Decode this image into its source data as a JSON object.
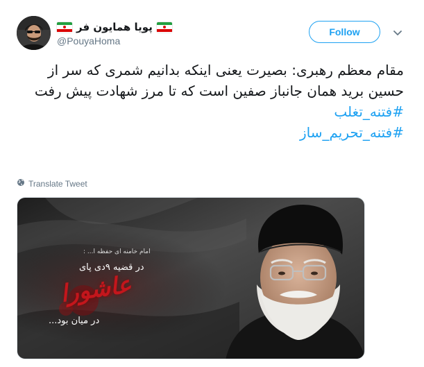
{
  "user": {
    "display_name": "پویا همایون فر",
    "handle": "@PouyaHoma",
    "avatar_icon": "user-avatar",
    "flag_icon": "iran-flag-emoji"
  },
  "actions": {
    "follow_label": "Follow",
    "more_icon": "chevron-down-icon"
  },
  "tweet": {
    "text": "مقام معظم رهبری: بصیرت یعنی اینکه بدانیم شمری که سر از حسین برید همان جانباز صفین است که تا مرز شهادت پیش رفت",
    "hashtags": [
      "#فتنه_تغلب",
      "#فتنه_تحریم_ساز"
    ]
  },
  "translate": {
    "label": "Translate Tweet",
    "icon": "globe-icon"
  },
  "media": {
    "overlay_line1": "امام خامنه ای حفظه ا... :",
    "overlay_line2": "در قضیه ۹دی پای",
    "overlay_calligraphy": "عاشورا",
    "overlay_line3": "در میان بود...",
    "colors": {
      "background": "#3a3a3a",
      "accent_red": "#c3161c"
    }
  },
  "colors": {
    "accent": "#1da1f2",
    "text_primary": "#14171a",
    "text_secondary": "#657786",
    "border": "#e1e8ed"
  }
}
